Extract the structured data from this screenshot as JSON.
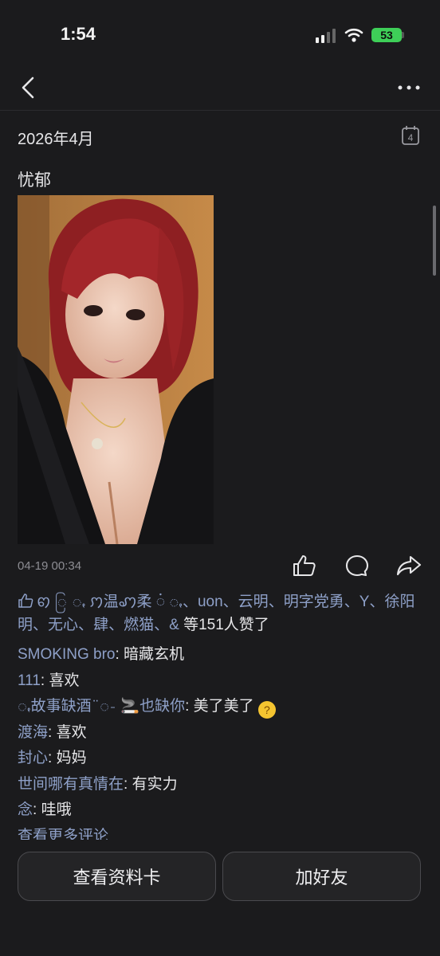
{
  "status_bar": {
    "time": "1:54",
    "battery": "53"
  },
  "header": {
    "date": "2026年4月",
    "calendar_day": "4"
  },
  "post": {
    "text": "忧郁",
    "time": "04-19 00:34",
    "likers": [
      "ꩅ ြ ꩻ ꩀ温ꩇ柔 ꩌ ꩻ",
      "uon",
      "云明",
      "明字党勇",
      "Y",
      "徐阳明",
      "无心",
      "肆",
      "燃猫",
      "&"
    ],
    "likes_suffix": " 等151人赞了"
  },
  "comments": [
    {
      "name": "SMOKING bro",
      "text": "暗藏玄机"
    },
    {
      "name": "111",
      "text": "喜欢"
    },
    {
      "name": "ꩻ故事缺酒 ̈ ꩽ 🚬也缺你",
      "text": "美了美了",
      "emoji": "🤔"
    },
    {
      "name": "渡海",
      "text": "喜欢"
    },
    {
      "name": "封心",
      "text": "妈妈"
    },
    {
      "name": "世间哪有真情在",
      "text": "有实力"
    },
    {
      "name": "念",
      "text": "哇哦"
    }
  ],
  "more_comments": "查看更多评论",
  "actions": {
    "profile_card": "查看资料卡",
    "add_friend": "加好友"
  },
  "colors": {
    "background": "#1b1b1d",
    "name_link": "#8ea0c8",
    "battery": "#3ecf58"
  },
  "icons": [
    "back-icon",
    "more-icon",
    "calendar-icon",
    "like-icon",
    "comment-icon",
    "share-icon"
  ]
}
